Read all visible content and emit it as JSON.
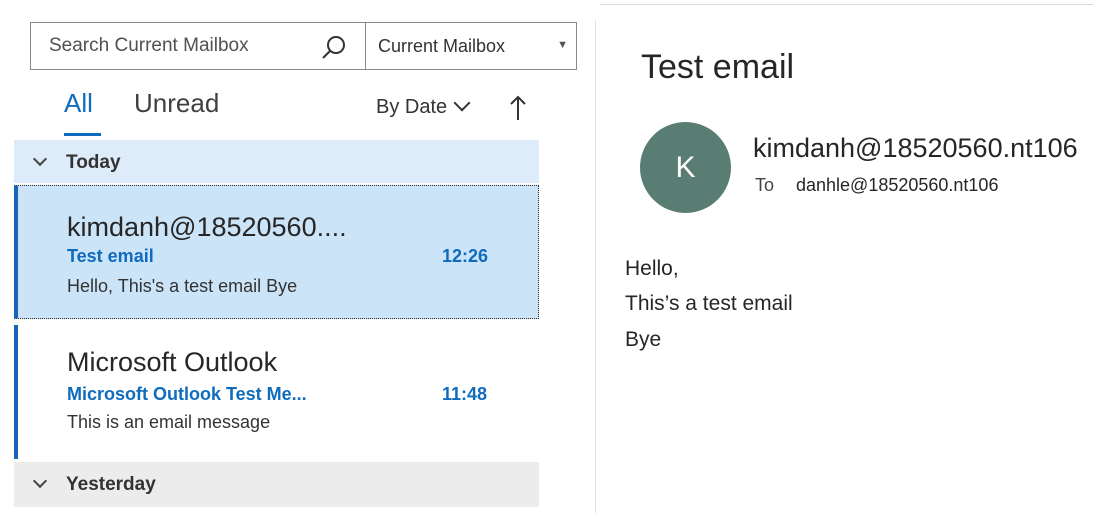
{
  "search": {
    "placeholder": "Search Current Mailbox",
    "scope": "Current Mailbox"
  },
  "tabs": [
    {
      "label": "All",
      "active": true
    },
    {
      "label": "Unread",
      "active": false
    }
  ],
  "sort": {
    "label": "By Date",
    "direction_icon": "arrow-up-icon"
  },
  "groups": [
    {
      "label": "Today"
    },
    {
      "label": "Yesterday"
    }
  ],
  "messages": [
    {
      "sender": "kimdanh@18520560....",
      "subject": "Test email",
      "time": "12:26",
      "preview": "Hello,  This's a test email  Bye",
      "selected": true
    },
    {
      "sender": "Microsoft Outlook",
      "subject": "Microsoft Outlook Test Me...",
      "time": "11:48",
      "preview": "This is an email message",
      "selected": false
    }
  ],
  "reading": {
    "title": "Test email",
    "avatar_initial": "K",
    "from": "kimdanh@18520560.nt106",
    "to_label": "To",
    "to": "danhle@18520560.nt106",
    "body_lines": [
      "Hello,",
      "This’s a test email",
      "Bye"
    ]
  },
  "colors": {
    "accent": "#0f6cbd",
    "selected_bg": "#cce4f7",
    "today_header_bg": "#deecf9",
    "yesterday_header_bg": "#ececec",
    "avatar_bg": "#5a7d73"
  }
}
